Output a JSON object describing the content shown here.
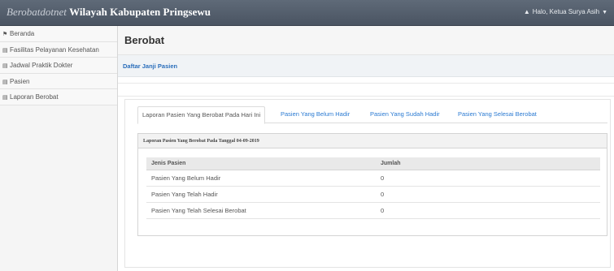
{
  "navbar": {
    "brand_italic": "Berobatdotnet",
    "brand_bold": "Wilayah Kabupaten Pringsewu",
    "user_label": "Halo, Ketua Surya Asih",
    "user_icon": "user-icon",
    "caret_icon": "caret-down-icon"
  },
  "sidebar": {
    "items": [
      {
        "label": "Beranda",
        "icon": "home-icon"
      },
      {
        "label": "Fasilitas Pelayanan Kesehatan",
        "icon": "document-icon"
      },
      {
        "label": "Jadwal Praktik Dokter",
        "icon": "document-icon"
      },
      {
        "label": "Pasien",
        "icon": "document-icon"
      },
      {
        "label": "Laporan Berobat",
        "icon": "document-icon"
      }
    ]
  },
  "main": {
    "page_title": "Berobat",
    "subbar_link": "Daftar Janji Pasien",
    "tabs": [
      {
        "label": "Laporan Pasien Yang Berobat Pada Hari Ini",
        "active": true
      },
      {
        "label": "Pasien Yang Belum Hadir",
        "active": false
      },
      {
        "label": "Pasien Yang Sudah Hadir",
        "active": false
      },
      {
        "label": "Pasien Yang Selesai Berobat",
        "active": false
      }
    ],
    "report": {
      "heading": "Laporan Pasien Yang Berobat Pada Tanggal 04-09-2019",
      "columns": [
        "Jenis Pasien",
        "Jumlah"
      ],
      "rows": [
        [
          "Pasien Yang Belum Hadir",
          "0"
        ],
        [
          "Pasien Yang Telah Hadir",
          "0"
        ],
        [
          "Pasien Yang Telah Selesai Berobat",
          "0"
        ]
      ]
    }
  },
  "colors": {
    "navbar": "#4f5966",
    "link": "#2a7ad2",
    "sidebar": "#f5f5f5"
  }
}
